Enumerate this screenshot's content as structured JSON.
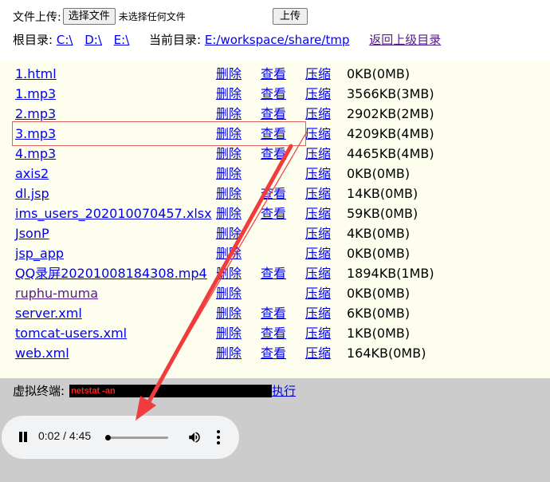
{
  "upload": {
    "label": "文件上传:",
    "choose_button": "选择文件",
    "no_file": "未选择任何文件",
    "upload_button": "上传"
  },
  "roots": {
    "label": "根目录:",
    "items": [
      "C:\\",
      "D:\\",
      "E:\\"
    ],
    "current_label": "当前目录:",
    "current_path": "E:/workspace/share/tmp",
    "back_label": "返回上级目录"
  },
  "actions": {
    "delete": "删除",
    "view": "查看",
    "compress": "压缩"
  },
  "files": [
    {
      "name": "1.html",
      "size": "0KB(0MB)",
      "view": true
    },
    {
      "name": "1.mp3",
      "size": "3566KB(3MB)",
      "view": true
    },
    {
      "name": "2.mp3",
      "size": "2902KB(2MB)",
      "view": true
    },
    {
      "name": "3.mp3",
      "size": "4209KB(4MB)",
      "view": true
    },
    {
      "name": "4.mp3",
      "size": "4465KB(4MB)",
      "view": true
    },
    {
      "name": "axis2",
      "size": "0KB(0MB)",
      "view": false
    },
    {
      "name": "dl.jsp",
      "size": "14KB(0MB)",
      "view": true
    },
    {
      "name": "ims_users_202010070457.xlsx",
      "size": "59KB(0MB)",
      "view": true
    },
    {
      "name": "JsonP",
      "size": "4KB(0MB)",
      "view": false
    },
    {
      "name": "jsp_app",
      "size": "0KB(0MB)",
      "view": false
    },
    {
      "name": "QQ录屏20201008184308.mp4",
      "size": "1894KB(1MB)",
      "view": true
    },
    {
      "name": "ruphu-muma",
      "size": "0KB(0MB)",
      "view": false
    },
    {
      "name": "server.xml",
      "size": "6KB(0MB)",
      "view": true
    },
    {
      "name": "tomcat-users.xml",
      "size": "1KB(0MB)",
      "view": true
    },
    {
      "name": "web.xml",
      "size": "164KB(0MB)",
      "view": true
    }
  ],
  "terminal": {
    "label": "虚拟终端:",
    "command": "netstat -an",
    "exec_label": "执行"
  },
  "player": {
    "time": "0:02 / 4:45",
    "progress": 0.007,
    "state": "playing"
  },
  "colors": {
    "file_panel_bg": "#fefeee",
    "bottom_bg": "#cccccc",
    "link": "#0000ee",
    "visited": "#551a8b",
    "arrow": "#f03c3c",
    "terminal_text": "#ff2020"
  }
}
